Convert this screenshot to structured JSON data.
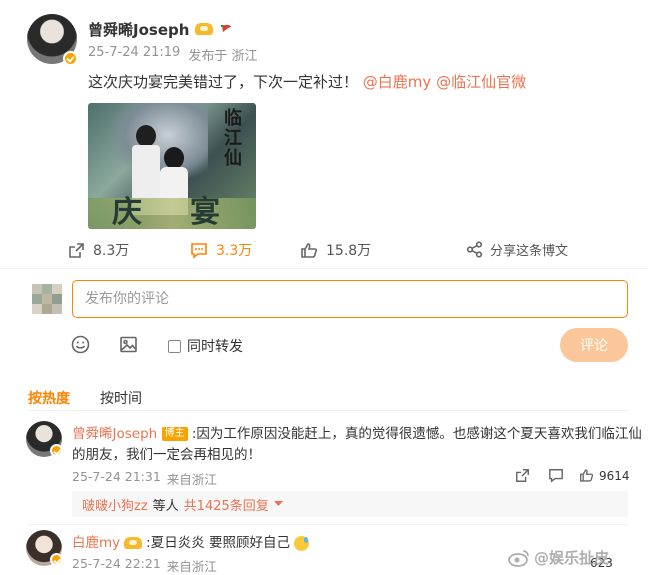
{
  "post": {
    "author": "曾舜晞Joseph",
    "timestamp": "25-7-24 21:19",
    "source": "发布于 浙江",
    "text": "这次庆功宴完美错过了，下次一定补过！",
    "mention1": "@白鹿my",
    "mention2": "@临江仙官微",
    "image_text_title": "临江仙",
    "image_text_banner_left": "庆",
    "image_text_banner_right": "宴",
    "actions": {
      "repost": "8.3万",
      "comment": "3.3万",
      "like": "15.8万",
      "share": "分享这条博文"
    }
  },
  "composer": {
    "placeholder": "发布你的评论",
    "forward_label": "同时转发",
    "submit_label": "评论"
  },
  "sort_tabs": {
    "hot": "按热度",
    "time": "按时间"
  },
  "comments": [
    {
      "author": "曾舜晞Joseph",
      "badge": "博主",
      "text": ":因为工作原因没能赶上，真的觉得很遗憾。也感谢这个夏天喜欢我们临江仙的朋友，我们一定会再相见的！",
      "text_line1": ":因为工作原因没能赶上，真的觉得很遗憾。也感谢这个夏天喜欢我们临江仙",
      "text_line2": "的朋友，我们一定会再相见的！",
      "timestamp": "25-7-24 21:31",
      "source": "来自浙江",
      "likes": "9614",
      "reply_user": "啵啵小狗zz",
      "reply_etc": "等人",
      "reply_count": "共1425条回复"
    },
    {
      "author": "白鹿my",
      "text": ":夏日炎炎 要照顾好自己",
      "timestamp": "25-7-24 22:21",
      "source": "来自浙江",
      "likes": "623"
    }
  ],
  "watermark": "@娱乐扯皮",
  "colors": {
    "accent": "#ff8200",
    "link": "#eb7350",
    "submit_bg": "#fbc79a"
  }
}
